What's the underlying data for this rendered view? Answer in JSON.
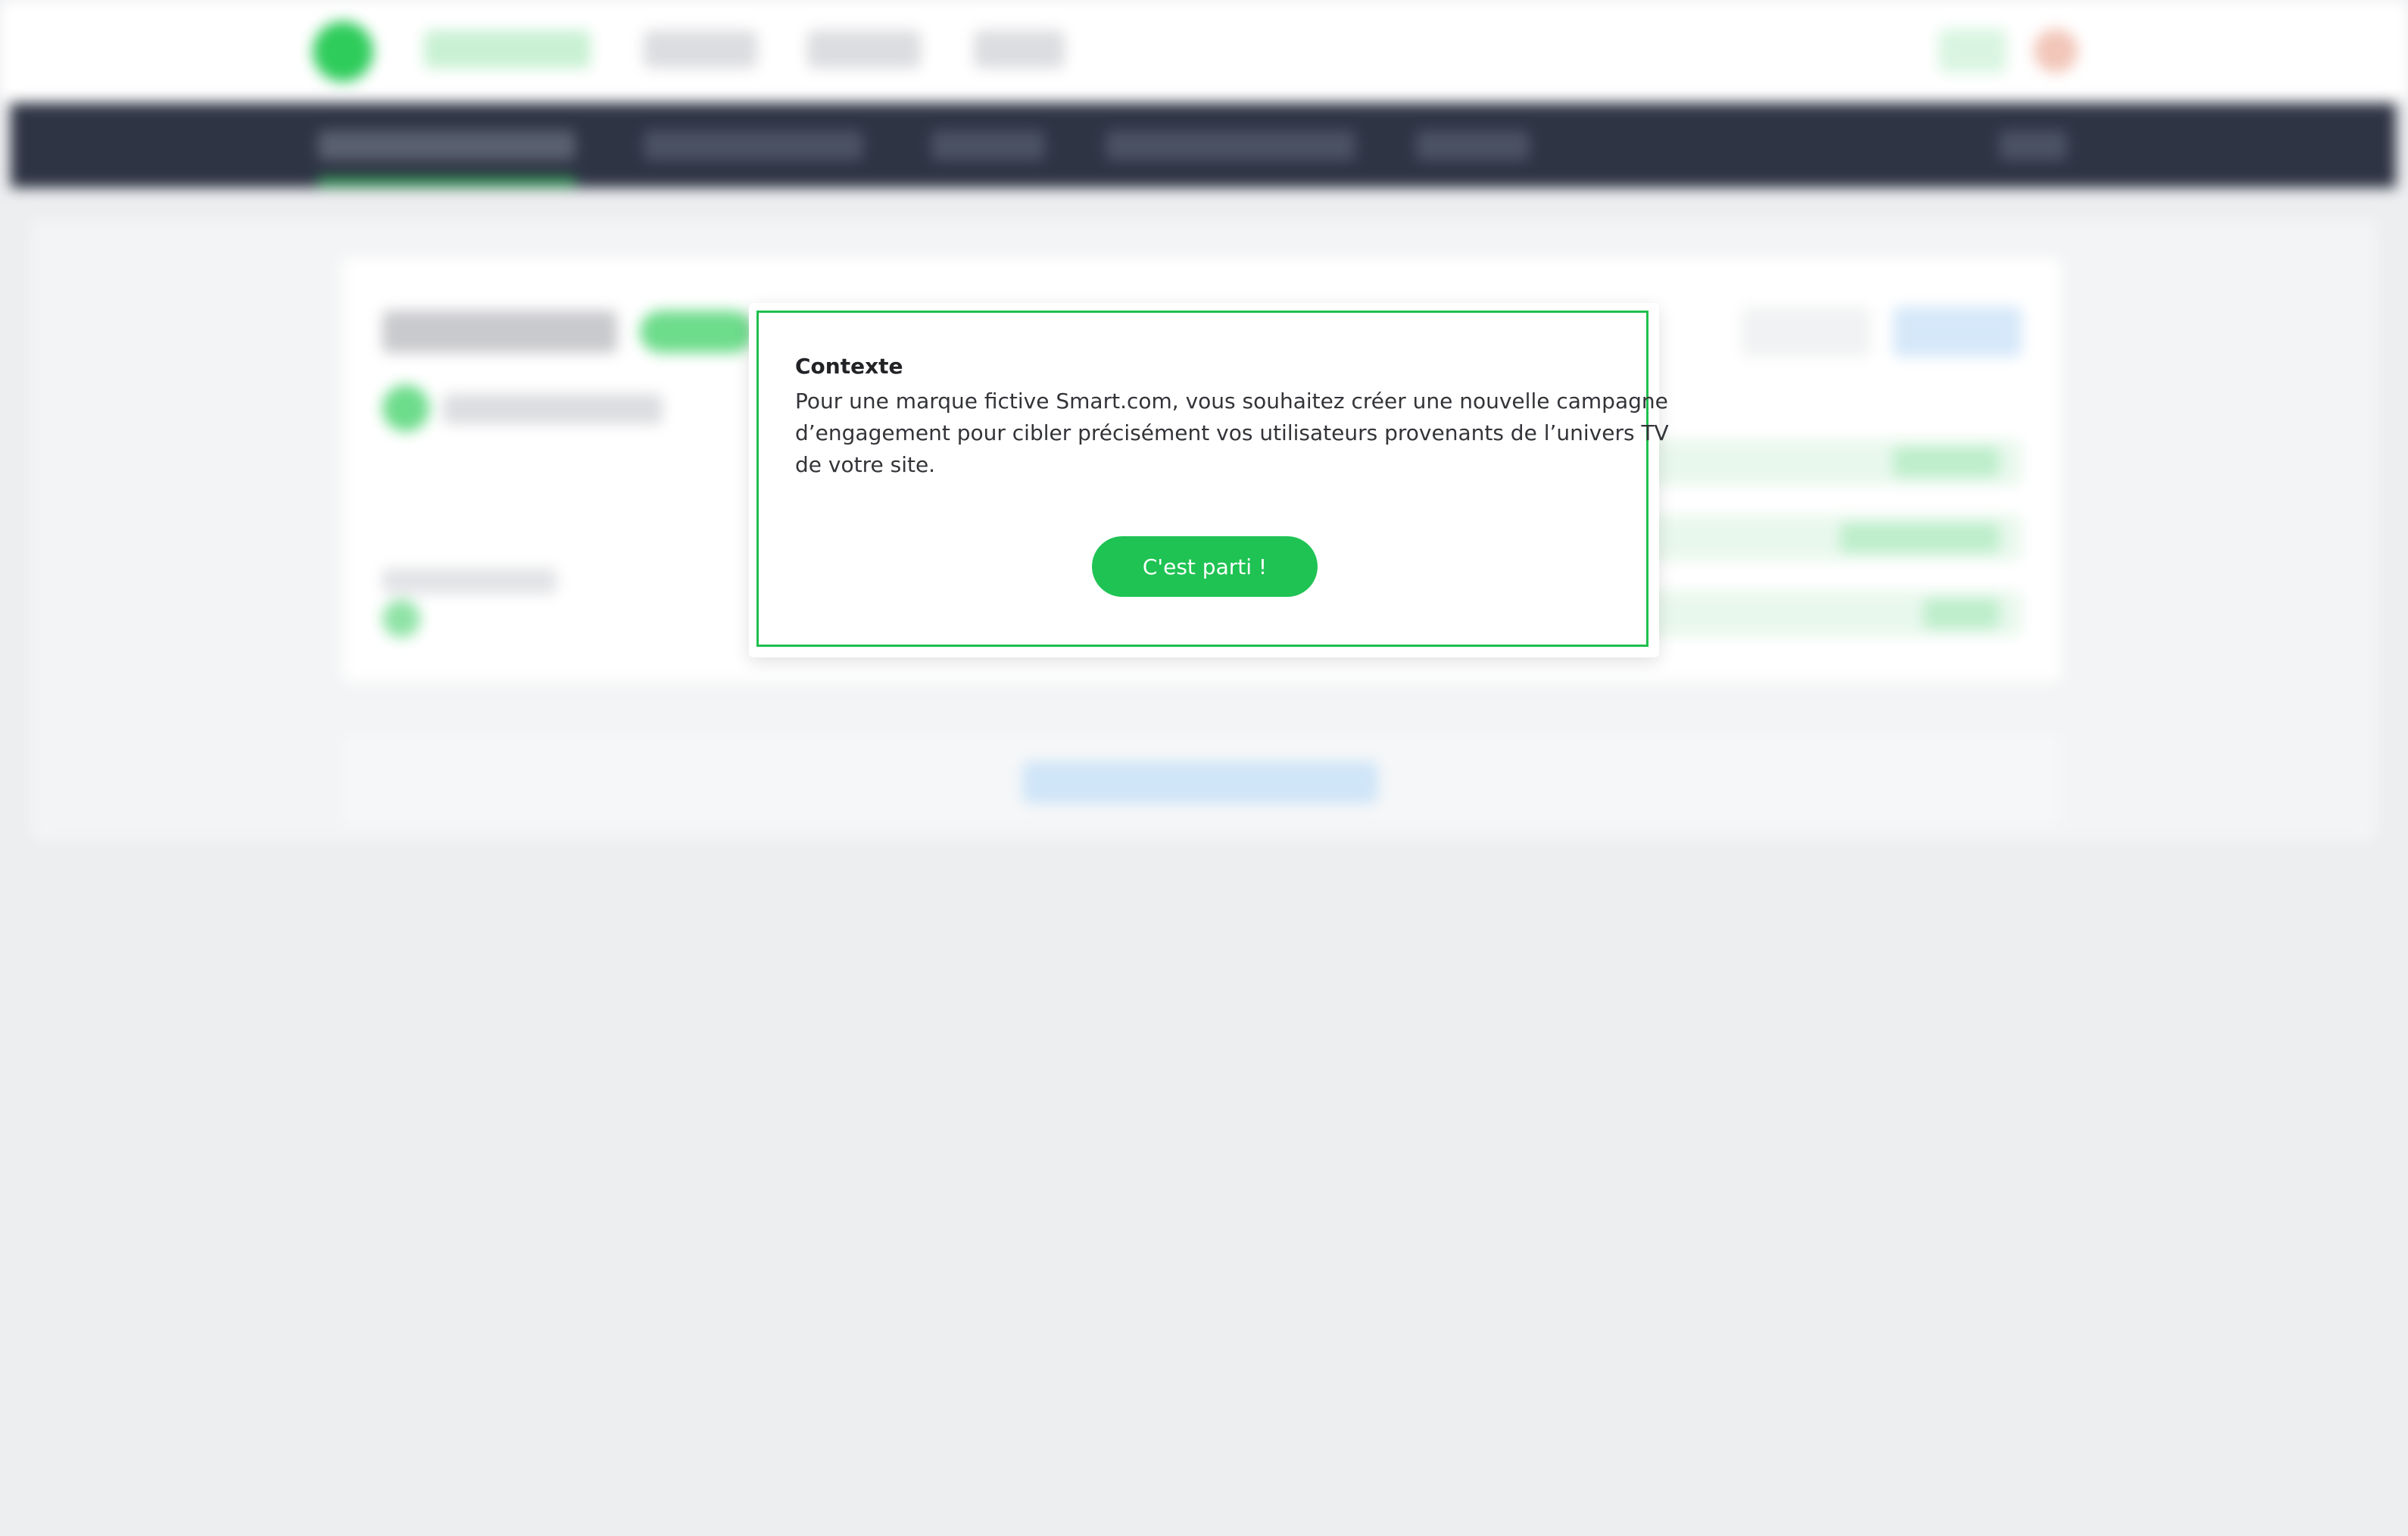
{
  "modal": {
    "title": "Contexte",
    "body_lines": [
      "Pour une marque fictive Smart.com, vous souhaitez créer une nouvelle campagne",
      "d’engagement pour cibler précisément vos utilisateurs provenants de l’univers TV",
      "de votre site."
    ],
    "start_button_label": "C'est parti !"
  },
  "colors": {
    "accent_green": "#1fc353",
    "modal_border": "#1fbf4d",
    "dark_nav": "#2e3444",
    "page_background": "#edeef0"
  },
  "background_state": "blurred"
}
